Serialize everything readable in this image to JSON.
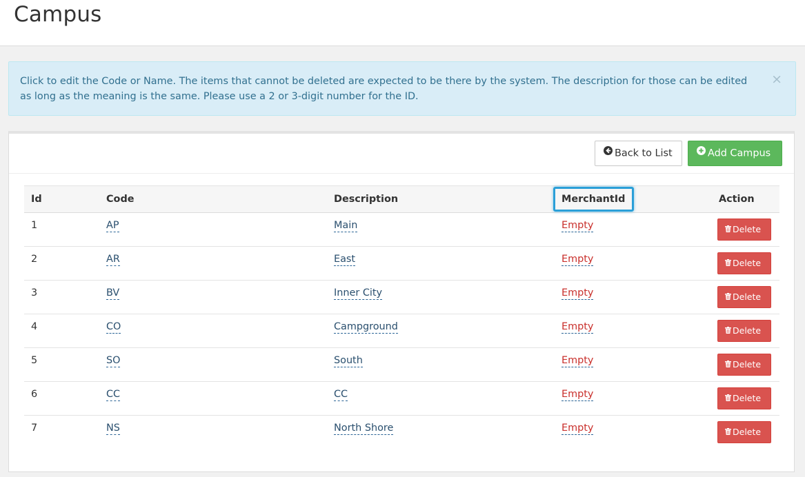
{
  "header": {
    "title": "Campus"
  },
  "alert": {
    "message": "Click to edit the Code or Name. The items that cannot be deleted are expected to be there by the system. The description for those can be edited as long as the meaning is the same. Please use a 2 or 3-digit number for the ID.",
    "close_glyph": "×"
  },
  "toolbar": {
    "back_label": "Back to List",
    "back_icon": "arrow-circle-left-icon",
    "add_label": "Add Campus",
    "add_icon": "plus-circle-icon"
  },
  "table": {
    "columns": [
      "Id",
      "Code",
      "Description",
      "MerchantId",
      "Action"
    ],
    "rows": [
      {
        "id": "1",
        "code": "AP",
        "description": "Main",
        "merchant_id": "Empty",
        "action": "Delete"
      },
      {
        "id": "2",
        "code": "AR",
        "description": "East",
        "merchant_id": "Empty",
        "action": "Delete"
      },
      {
        "id": "3",
        "code": "BV",
        "description": "Inner City",
        "merchant_id": "Empty",
        "action": "Delete"
      },
      {
        "id": "4",
        "code": "CO",
        "description": "Campground",
        "merchant_id": "Empty",
        "action": "Delete"
      },
      {
        "id": "5",
        "code": "SO",
        "description": "South",
        "merchant_id": "Empty",
        "action": "Delete"
      },
      {
        "id": "6",
        "code": "CC",
        "description": "CC",
        "merchant_id": "Empty",
        "action": "Delete"
      },
      {
        "id": "7",
        "code": "NS",
        "description": "North Shore",
        "merchant_id": "Empty",
        "action": "Delete"
      }
    ],
    "delete_icon": "trash-icon"
  },
  "colors": {
    "success": "#5cb85c",
    "danger": "#d9534f",
    "info_bg": "#d9edf7",
    "highlight": "#2a9fd8"
  }
}
